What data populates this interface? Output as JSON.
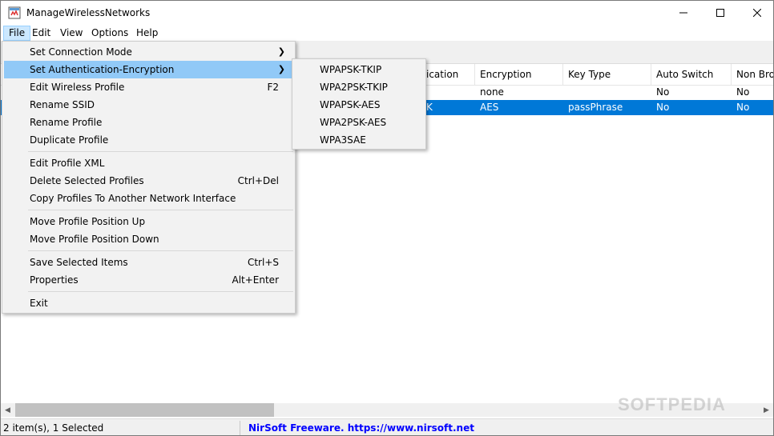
{
  "window": {
    "title": "ManageWirelessNetworks"
  },
  "menubar": [
    "File",
    "Edit",
    "View",
    "Options",
    "Help"
  ],
  "columns": [
    "ication",
    "Encryption",
    "Key Type",
    "Auto Switch",
    "Non Broa"
  ],
  "rows": [
    {
      "c1": "",
      "c2": "none",
      "c3": "",
      "c4": "No",
      "c5": "No"
    },
    {
      "c1": "K",
      "c2": "AES",
      "c3": "passPhrase",
      "c4": "No",
      "c5": "No"
    }
  ],
  "file_menu": {
    "set_connection_mode": "Set Connection Mode",
    "set_auth_encryption": "Set Authentication-Encryption",
    "edit_wireless_profile": "Edit Wireless Profile",
    "edit_wireless_profile_shortcut": "F2",
    "rename_ssid": "Rename SSID",
    "rename_profile": "Rename Profile",
    "duplicate_profile": "Duplicate Profile",
    "edit_profile_xml": "Edit Profile XML",
    "delete_selected_profiles": "Delete Selected Profiles",
    "delete_selected_profiles_shortcut": "Ctrl+Del",
    "copy_profiles": "Copy Profiles To Another Network Interface",
    "move_up": "Move Profile Position Up",
    "move_down": "Move Profile Position Down",
    "save_selected": "Save Selected Items",
    "save_selected_shortcut": "Ctrl+S",
    "properties": "Properties",
    "properties_shortcut": "Alt+Enter",
    "exit": "Exit"
  },
  "submenu": [
    "WPAPSK-TKIP",
    "WPA2PSK-TKIP",
    "WPAPSK-AES",
    "WPA2PSK-AES",
    "WPA3SAE"
  ],
  "status": {
    "items": "2 item(s), 1 Selected",
    "credit": "NirSoft Freeware. https://www.nirsoft.net"
  },
  "watermark": "SOFTPEDIA",
  "colors": {
    "selection": "#0078d7",
    "menu_highlight": "#91c9f7",
    "link": "#0000ff"
  },
  "icons": [
    "app-icon",
    "minimize-icon",
    "maximize-icon",
    "close-icon",
    "submenu-arrow-icon",
    "scroll-left-icon",
    "scroll-right-icon"
  ]
}
